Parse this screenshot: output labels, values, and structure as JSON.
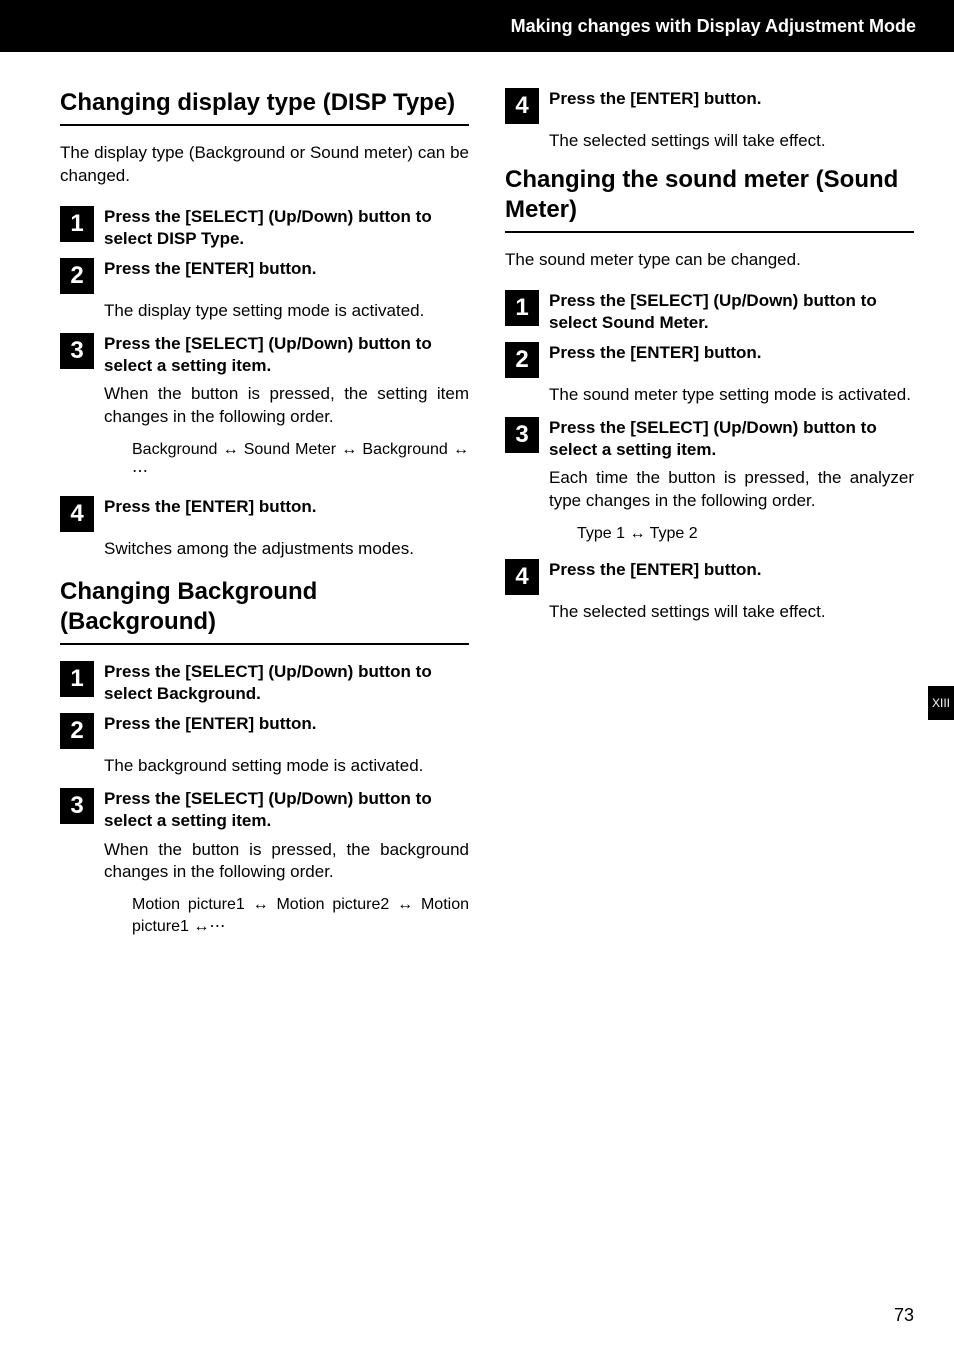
{
  "header": {
    "title": "Making changes with Display Adjustment Mode"
  },
  "side_tab": "XIII",
  "page_number": "73",
  "sections": [
    {
      "heading": "Changing display type (DISP Type)",
      "intro": "The display type (Background or Sound meter) can be changed.",
      "steps": [
        {
          "num": "1",
          "title": "Press the [SELECT] (Up/Down) button to select DISP Type."
        },
        {
          "num": "2",
          "title": "Press the [ENTER] button.",
          "body": "The display type setting mode is activated."
        },
        {
          "num": "3",
          "title": "Press the [SELECT] (Up/Down) button to select a setting item.",
          "body": "When the button is pressed, the setting item changes in the following order.",
          "sub": "Background ↔ Sound Meter ↔ Background ↔ ⋯"
        },
        {
          "num": "4",
          "title": "Press the [ENTER] button.",
          "body": "Switches among the adjustments modes."
        }
      ]
    },
    {
      "heading": "Changing Background (Background)",
      "steps": [
        {
          "num": "1",
          "title": "Press the [SELECT] (Up/Down) button to select Background."
        },
        {
          "num": "2",
          "title": "Press the [ENTER] button.",
          "body": "The background setting mode is activated."
        },
        {
          "num": "3",
          "title": "Press the [SELECT] (Up/Down) button to select a setting item.",
          "body": "When the button is pressed, the background changes in the following order.",
          "sub": "Motion picture1 ↔ Motion picture2 ↔ Motion picture1 ↔⋯"
        }
      ]
    },
    {
      "steps": [
        {
          "num": "4",
          "title": "Press the [ENTER] button.",
          "body": "The selected settings will take effect."
        }
      ]
    },
    {
      "heading": "Changing the sound meter (Sound Meter)",
      "intro": "The sound meter type can be changed.",
      "steps": [
        {
          "num": "1",
          "title": "Press the [SELECT] (Up/Down) button to select Sound Meter."
        },
        {
          "num": "2",
          "title": "Press the [ENTER] button.",
          "body": "The sound meter type setting mode is activated."
        },
        {
          "num": "3",
          "title": "Press the [SELECT] (Up/Down) button to select a setting item.",
          "body": "Each time the button is pressed, the analyzer type changes in the following order.",
          "sub": "Type 1 ↔ Type 2"
        },
        {
          "num": "4",
          "title": "Press the [ENTER] button.",
          "body": "The selected settings will take effect."
        }
      ]
    }
  ]
}
